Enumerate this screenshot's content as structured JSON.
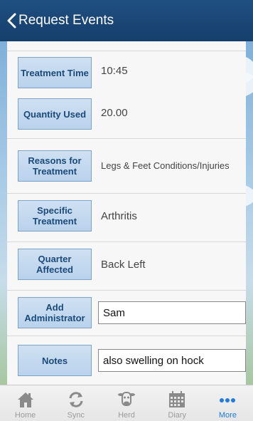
{
  "nav": {
    "title": "Request Events"
  },
  "rows": [
    {
      "label": "Treatment Time",
      "value": "10:45"
    },
    {
      "label": "Quantity Used",
      "value": "20.00"
    },
    {
      "label": "Reasons for Treatment",
      "value": "Legs & Feet  Conditions/Injuries"
    },
    {
      "label": "Specific Treatment",
      "value": "Arthritis"
    },
    {
      "label": "Quarter Affected",
      "value": "Back Left"
    },
    {
      "label": "Add Administrator",
      "value": "Sam"
    },
    {
      "label": "Notes",
      "value": "also swelling on hock"
    }
  ],
  "tabs": [
    {
      "label": "Home",
      "icon": "home-icon"
    },
    {
      "label": "Sync",
      "icon": "sync-icon"
    },
    {
      "label": "Herd",
      "icon": "cow-icon"
    },
    {
      "label": "Diary",
      "icon": "calendar-icon"
    },
    {
      "label": "More",
      "icon": "more-icon",
      "active": true
    }
  ],
  "colors": {
    "nav": "#1f4f82",
    "label_bg": "#c4d9ef",
    "label_text": "#1b4a7a",
    "active_tab": "#1e7be0"
  }
}
